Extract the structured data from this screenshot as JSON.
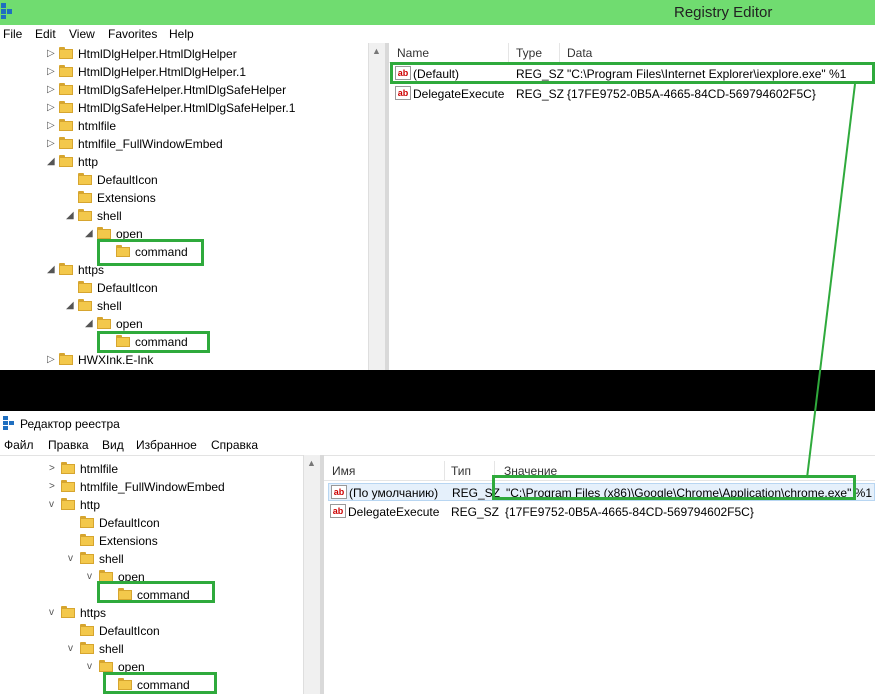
{
  "top": {
    "title": "Registry Editor",
    "menu": [
      "File",
      "Edit",
      "View",
      "Favorites",
      "Help"
    ],
    "tree": [
      {
        "label": "HtmlDlgHelper.HtmlDlgHelper",
        "arrow": "▷"
      },
      {
        "label": "HtmlDlgHelper.HtmlDlgHelper.1",
        "arrow": "▷"
      },
      {
        "label": "HtmlDlgSafeHelper.HtmlDlgSafeHelper",
        "arrow": "▷"
      },
      {
        "label": "HtmlDlgSafeHelper.HtmlDlgSafeHelper.1",
        "arrow": "▷"
      },
      {
        "label": "htmlfile",
        "arrow": "▷"
      },
      {
        "label": "htmlfile_FullWindowEmbed",
        "arrow": "▷"
      },
      {
        "label": "http",
        "arrow": "◢"
      },
      {
        "label": "DefaultIcon",
        "arrow": ""
      },
      {
        "label": "Extensions",
        "arrow": ""
      },
      {
        "label": "shell",
        "arrow": "◢"
      },
      {
        "label": "open",
        "arrow": "◢"
      },
      {
        "label": "command",
        "arrow": ""
      },
      {
        "label": "https",
        "arrow": "◢"
      },
      {
        "label": "DefaultIcon",
        "arrow": ""
      },
      {
        "label": "shell",
        "arrow": "◢"
      },
      {
        "label": "open",
        "arrow": "◢"
      },
      {
        "label": "command",
        "arrow": ""
      },
      {
        "label": "HWXInk.E-Ink",
        "arrow": "▷"
      }
    ],
    "columns": [
      "Name",
      "Type",
      "Data"
    ],
    "rows": [
      {
        "name": "(Default)",
        "type": "REG_SZ",
        "data": "\"C:\\Program Files\\Internet Explorer\\iexplore.exe\" %1"
      },
      {
        "name": "DelegateExecute",
        "type": "REG_SZ",
        "data": "{17FE9752-0B5A-4665-84CD-569794602F5C}"
      }
    ]
  },
  "bottom": {
    "title": "Редактор реестра",
    "menu": [
      "Файл",
      "Правка",
      "Вид",
      "Избранное",
      "Справка"
    ],
    "tree": [
      {
        "label": "htmlfile",
        "arrow": ">"
      },
      {
        "label": "htmlfile_FullWindowEmbed",
        "arrow": ">"
      },
      {
        "label": "http",
        "arrow": "v"
      },
      {
        "label": "DefaultIcon",
        "arrow": ""
      },
      {
        "label": "Extensions",
        "arrow": ""
      },
      {
        "label": "shell",
        "arrow": "v"
      },
      {
        "label": "open",
        "arrow": "v"
      },
      {
        "label": "command",
        "arrow": ""
      },
      {
        "label": "https",
        "arrow": "v"
      },
      {
        "label": "DefaultIcon",
        "arrow": ""
      },
      {
        "label": "shell",
        "arrow": "v"
      },
      {
        "label": "open",
        "arrow": "v"
      },
      {
        "label": "command",
        "arrow": ""
      }
    ],
    "columns": [
      "Имя",
      "Тип",
      "Значение"
    ],
    "rows": [
      {
        "name": "(По умолчанию)",
        "type": "REG_SZ",
        "data": "\"C:\\Program Files (x86)\\Google\\Chrome\\Application\\chrome.exe\" %1"
      },
      {
        "name": "DelegateExecute",
        "type": "REG_SZ",
        "data": "{17FE9752-0B5A-4665-84CD-569794602F5C}"
      }
    ]
  },
  "colors": {
    "highlight": "#2faa3c",
    "titlebar": "#70dc70",
    "folder": "#f3c84b",
    "separator": "#000000"
  },
  "icons": {
    "folder": "folder-icon",
    "string_value": "reg-string-icon",
    "app": "registry-editor-icon"
  }
}
